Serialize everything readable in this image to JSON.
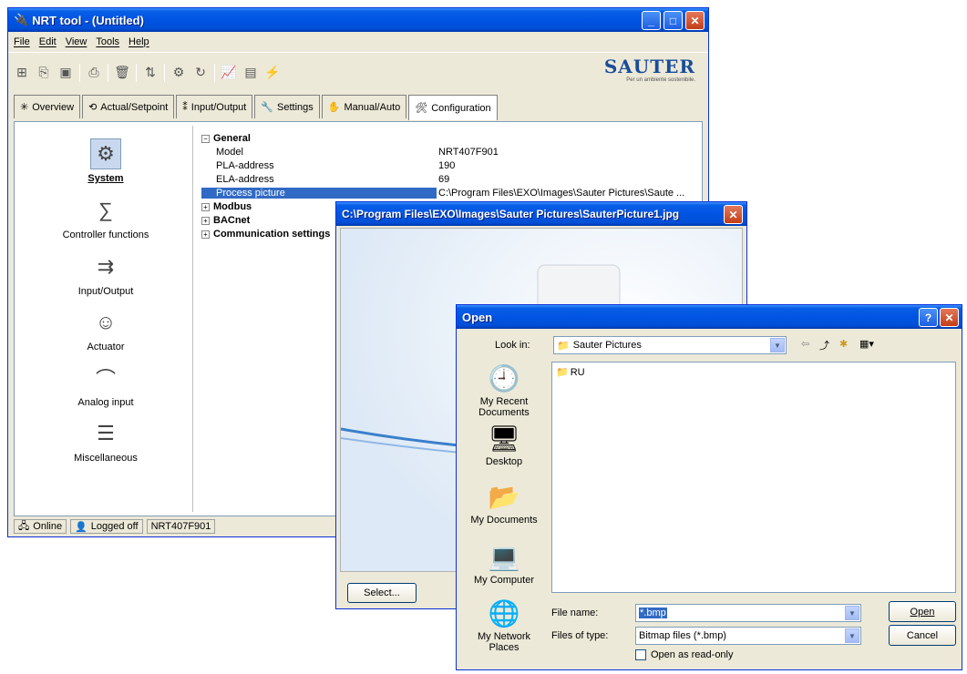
{
  "main_window": {
    "title": "NRT tool - (Untitled)",
    "menu": [
      "File",
      "Edit",
      "View",
      "Tools",
      "Help"
    ],
    "logo": {
      "brand": "SAUTER",
      "tagline": "Per un ambiente sostenibile."
    },
    "tabs": [
      {
        "label": "Overview",
        "icon": "overview-icon"
      },
      {
        "label": "Actual/Setpoint",
        "icon": "actual-setpoint-icon"
      },
      {
        "label": "Input/Output",
        "icon": "input-output-icon"
      },
      {
        "label": "Settings",
        "icon": "wrench-icon"
      },
      {
        "label": "Manual/Auto",
        "icon": "hand-icon"
      },
      {
        "label": "Configuration",
        "icon": "configuration-icon"
      }
    ],
    "sidebar": [
      {
        "label": "System",
        "icon": "gear-icon",
        "selected": true
      },
      {
        "label": "Controller functions",
        "icon": "function-icon"
      },
      {
        "label": "Input/Output",
        "icon": "input-output-icon"
      },
      {
        "label": "Actuator",
        "icon": "actuator-icon"
      },
      {
        "label": "Analog input",
        "icon": "analog-input-icon"
      },
      {
        "label": "Miscellaneous",
        "icon": "list-icon"
      }
    ],
    "properties": {
      "general": "General",
      "rows": [
        {
          "key": "Model",
          "value": "NRT407F901"
        },
        {
          "key": "PLA-address",
          "value": "190"
        },
        {
          "key": "ELA-address",
          "value": "69"
        },
        {
          "key": "Process picture",
          "value": "C:\\Program Files\\EXO\\Images\\Sauter Pictures\\Saute ..."
        }
      ],
      "collapsed": [
        "Modbus",
        "BACnet",
        "Communication settings"
      ]
    },
    "status": {
      "online": "Online",
      "logged": "Logged off",
      "device": "NRT407F901"
    }
  },
  "picture_window": {
    "title": "C:\\Program Files\\EXO\\Images\\Sauter Pictures\\SauterPicture1.jpg",
    "select_label": "Select..."
  },
  "open_dialog": {
    "title": "Open",
    "look_in_label": "Look in:",
    "look_in_value": "Sauter Pictures",
    "folders": [
      "RU"
    ],
    "places": [
      "My Recent Documents",
      "Desktop",
      "My Documents",
      "My Computer",
      "My Network Places"
    ],
    "file_name_label": "File name:",
    "file_name_value": "*.bmp",
    "file_type_label": "Files of type:",
    "file_type_value": "Bitmap files (*.bmp)",
    "readonly_label": "Open as read-only",
    "open_label": "Open",
    "cancel_label": "Cancel"
  }
}
